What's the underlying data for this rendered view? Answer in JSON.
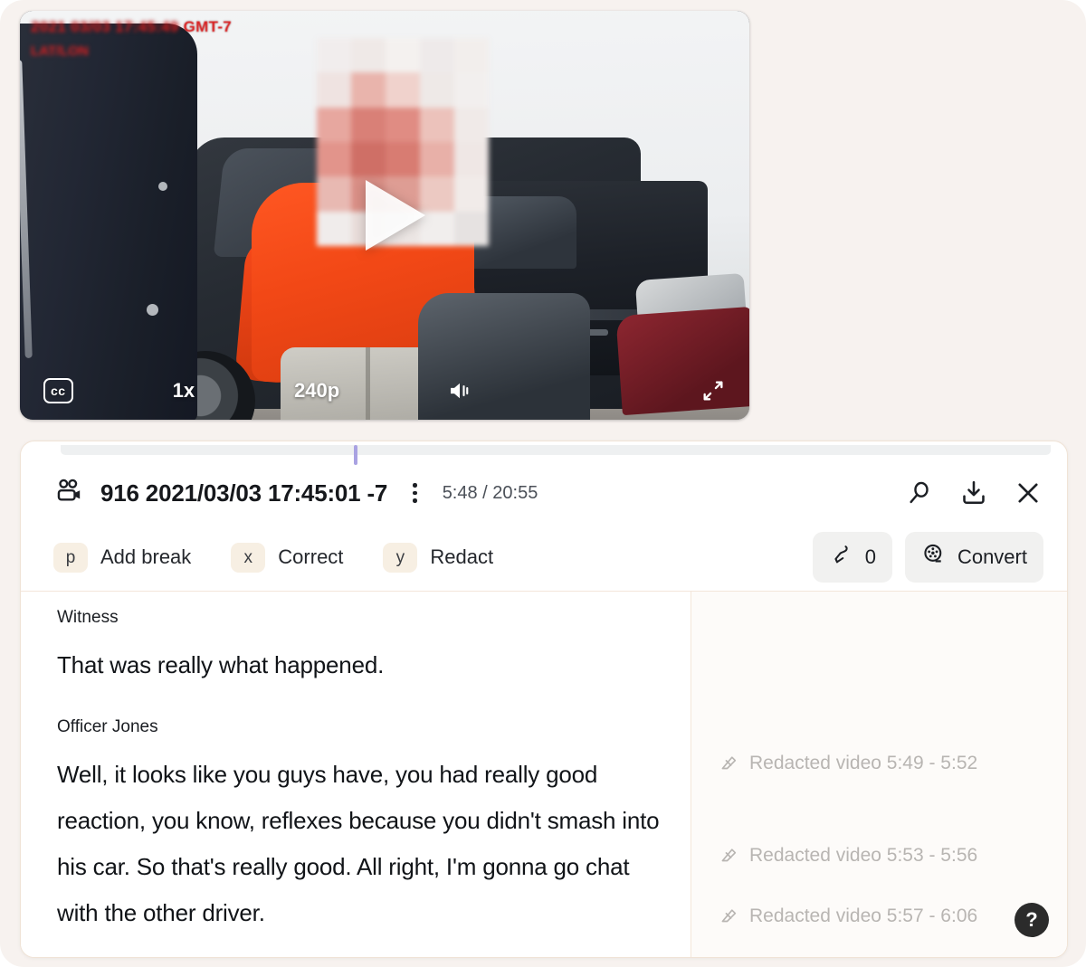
{
  "video": {
    "overlay_timestamp": "2021/03/03 17:45:49 GMT-7",
    "overlay_timestamp_visible_suffix": "GMT-7",
    "overlay_secondary": "LAT/LON",
    "play_button": "play-triangle",
    "controls": {
      "captions": "cc",
      "speed": "1x",
      "quality": "240p",
      "volume_icon": "volume-icon",
      "fullscreen_icon": "fullscreen-icon"
    }
  },
  "transcript": {
    "header": {
      "camera_icon": "video-camera-icon",
      "title": "916 2021/03/03 17:45:01 -7",
      "kebab": "kebab-menu-icon",
      "time": "5:48 / 20:55",
      "search_icon": "search-icon",
      "download_icon": "download-icon",
      "close_icon": "close-icon"
    },
    "actions": [
      {
        "key": "p",
        "label": "Add break"
      },
      {
        "key": "x",
        "label": "Correct"
      },
      {
        "key": "y",
        "label": "Redact"
      }
    ],
    "tools": {
      "highlight_icon": "highlighter-icon",
      "highlight_count": "0",
      "convert_icon": "film-reel-icon",
      "convert_label": "Convert"
    },
    "entries": [
      {
        "speaker": "Witness",
        "text": "That was really what happened."
      },
      {
        "speaker": "Officer Jones",
        "text": "Well, it looks like you guys have, you had really good reaction, you know, reflexes because you didn't smash into his car. So that's really good. All right, I'm gonna go chat with the other driver."
      }
    ],
    "redactions": [
      {
        "icon": "eraser-icon",
        "label": "Redacted video 5:49 - 5:52"
      },
      {
        "icon": "eraser-icon",
        "label": "Redacted video 5:53 - 5:56"
      },
      {
        "icon": "eraser-icon",
        "label": "Redacted video 5:57 - 6:06"
      }
    ],
    "help": "?"
  },
  "colors": {
    "page_bg": "#f7f2ef",
    "panel_bg": "#ffffff",
    "panel_border": "#f0e3d6",
    "key_chip_bg": "#f7efe3",
    "playhead": "#a9a2e2",
    "redaction_text": "#b8b5b2",
    "hoodie": "#f24816",
    "timestamp_red": "#d91f20"
  }
}
